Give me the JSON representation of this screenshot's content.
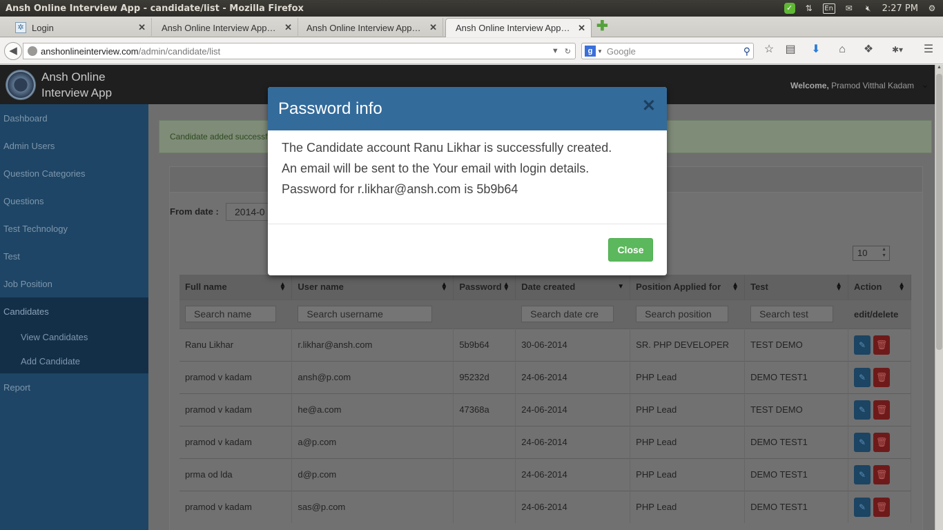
{
  "os": {
    "window_title": "Ansh Online Interview App - candidate/list - Mozilla Firefox",
    "keyboard": "En",
    "time": "2:27 PM"
  },
  "tabs": [
    {
      "label": "Login"
    },
    {
      "label": "Ansh Online Interview App -..."
    },
    {
      "label": "Ansh Online Interview App -..."
    },
    {
      "label": "Ansh Online Interview App -..."
    }
  ],
  "urlbar": {
    "host": "anshonlineinterview.com",
    "path": "/admin/candidate/list"
  },
  "search": {
    "placeholder": "Google"
  },
  "brand": {
    "line1": "Ansh Online",
    "line2": "Interview App"
  },
  "header": {
    "welcome_label": "Welcome,",
    "user": "Pramod Vitthal Kadam"
  },
  "sidebar": {
    "items": [
      {
        "label": "Dashboard"
      },
      {
        "label": "Admin Users"
      },
      {
        "label": "Question Categories"
      },
      {
        "label": "Questions"
      },
      {
        "label": "Test Technology"
      },
      {
        "label": "Test"
      },
      {
        "label": "Job Position"
      },
      {
        "label": "Candidates"
      },
      {
        "label": "Report"
      }
    ],
    "subitems": [
      {
        "label": "View Candidates"
      },
      {
        "label": "Add Candidate"
      }
    ]
  },
  "alert": {
    "text": "Candidate added successfully"
  },
  "filters": {
    "from_label": "From date :",
    "from_value": "2014-0",
    "page_size": "10"
  },
  "table": {
    "headers": [
      "Full name",
      "User name",
      "Password",
      "Date created",
      "Position Applied for",
      "Test",
      "Action"
    ],
    "filter_placeholders": [
      "Search name",
      "Search username",
      "",
      "Search date cre",
      "Search position",
      "Search test"
    ],
    "action_label": "edit/delete",
    "rows": [
      [
        "Ranu Likhar",
        "r.likhar@ansh.com",
        "5b9b64",
        "30-06-2014",
        "SR. PHP DEVELOPER",
        "TEST DEMO"
      ],
      [
        "pramod v kadam",
        "ansh@p.com",
        "95232d",
        "24-06-2014",
        "PHP Lead",
        "DEMO TEST1"
      ],
      [
        "pramod v kadam",
        "he@a.com",
        "47368a",
        "24-06-2014",
        "PHP Lead",
        "TEST DEMO"
      ],
      [
        "pramod v kadam",
        "a@p.com",
        "",
        "24-06-2014",
        "PHP Lead",
        "DEMO TEST1"
      ],
      [
        "prma od lda",
        "d@p.com",
        "",
        "24-06-2014",
        "PHP Lead",
        "DEMO TEST1"
      ],
      [
        "pramod v kadam",
        "sas@p.com",
        "",
        "24-06-2014",
        "PHP Lead",
        "DEMO TEST1"
      ]
    ]
  },
  "modal": {
    "title": "Password info",
    "line1": "The Candidate account Ranu Likhar is successfully created.",
    "line2": "An email will be sent to the Your email with login details.",
    "line3": "Password for r.likhar@ansh.com is 5b9b64",
    "close_label": "Close"
  },
  "colors": {
    "modal_header": "#336b9b",
    "close_button": "#5cb85c",
    "sidebar": "#1e4565"
  }
}
